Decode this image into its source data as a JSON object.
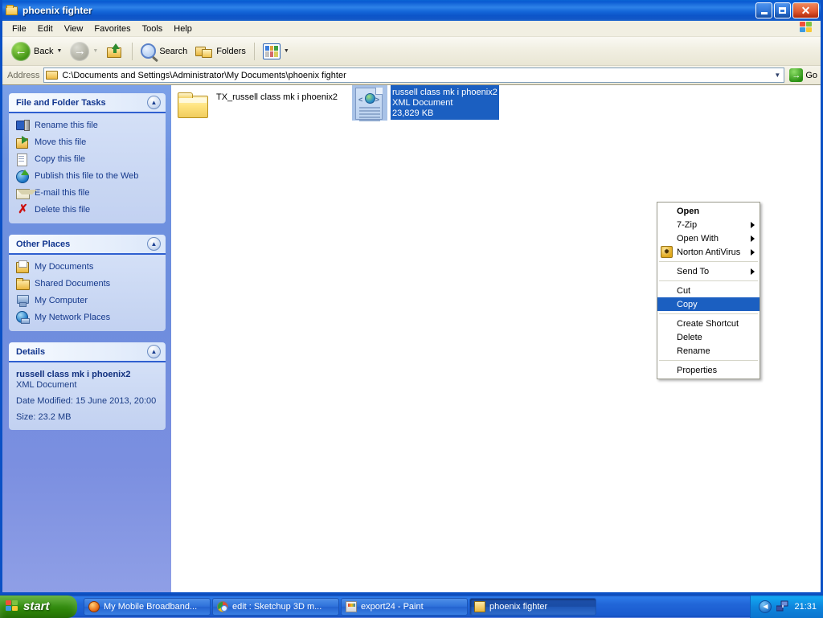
{
  "window": {
    "title": "phoenix fighter",
    "icon": "folder-icon",
    "buttons": {
      "minimize": "Minimize",
      "maximize": "Maximize",
      "close": "Close"
    }
  },
  "menubar": {
    "items": [
      "File",
      "Edit",
      "View",
      "Favorites",
      "Tools",
      "Help"
    ],
    "banner_icon": "windows-flag-icon"
  },
  "toolbar": {
    "back_label": "Back",
    "forward_label": "Forward",
    "up_label": "Up",
    "search_label": "Search",
    "folders_label": "Folders",
    "views_label": "Views"
  },
  "addressbar": {
    "label": "Address",
    "path": "C:\\Documents and Settings\\Administrator\\My Documents\\phoenix fighter",
    "go_label": "Go"
  },
  "sidebar": {
    "panels": [
      {
        "title": "File and Folder Tasks",
        "collapse_icon": "chevron-up-icon",
        "items": [
          {
            "label": "Rename this file",
            "icon": "rename-icon"
          },
          {
            "label": "Move this file",
            "icon": "move-icon"
          },
          {
            "label": "Copy this file",
            "icon": "copy-icon"
          },
          {
            "label": "Publish this file to the Web",
            "icon": "publish-web-icon"
          },
          {
            "label": "E-mail this file",
            "icon": "email-icon"
          },
          {
            "label": "Delete this file",
            "icon": "delete-icon"
          }
        ]
      },
      {
        "title": "Other Places",
        "collapse_icon": "chevron-up-icon",
        "items": [
          {
            "label": "My Documents",
            "icon": "my-documents-icon"
          },
          {
            "label": "Shared Documents",
            "icon": "shared-documents-icon"
          },
          {
            "label": "My Computer",
            "icon": "my-computer-icon"
          },
          {
            "label": "My Network Places",
            "icon": "my-network-places-icon"
          }
        ]
      }
    ],
    "details": {
      "title": "Details",
      "collapse_icon": "chevron-up-icon",
      "file_name": "russell class mk i phoenix2",
      "file_type": "XML Document",
      "date_modified": "Date Modified: 15 June 2013, 20:00",
      "size": "Size: 23.2 MB"
    }
  },
  "files": [
    {
      "name": "TX_russell class mk i phoenix2",
      "icon": "folder-icon",
      "selected": false
    },
    {
      "name": "russell class mk i phoenix2",
      "type": "XML Document",
      "size": "23,829 KB",
      "icon": "xml-document-icon",
      "selected": true
    }
  ],
  "context_menu": {
    "items": [
      {
        "label": "Open",
        "bold": true,
        "submenu": false,
        "selected": false,
        "icon": null
      },
      {
        "label": "7-Zip",
        "bold": false,
        "submenu": true,
        "selected": false,
        "icon": null
      },
      {
        "label": "Open With",
        "bold": false,
        "submenu": true,
        "selected": false,
        "icon": null
      },
      {
        "label": "Norton AntiVirus",
        "bold": false,
        "submenu": true,
        "selected": false,
        "icon": "norton-antivirus-icon"
      },
      {
        "separator": true
      },
      {
        "label": "Send To",
        "bold": false,
        "submenu": true,
        "selected": false,
        "icon": null
      },
      {
        "separator": true
      },
      {
        "label": "Cut",
        "bold": false,
        "submenu": false,
        "selected": false,
        "icon": null
      },
      {
        "label": "Copy",
        "bold": false,
        "submenu": false,
        "selected": true,
        "icon": null
      },
      {
        "separator": true
      },
      {
        "label": "Create Shortcut",
        "bold": false,
        "submenu": false,
        "selected": false,
        "icon": null
      },
      {
        "label": "Delete",
        "bold": false,
        "submenu": false,
        "selected": false,
        "icon": null
      },
      {
        "label": "Rename",
        "bold": false,
        "submenu": false,
        "selected": false,
        "icon": null
      },
      {
        "separator": true
      },
      {
        "label": "Properties",
        "bold": false,
        "submenu": false,
        "selected": false,
        "icon": null
      }
    ]
  },
  "taskbar": {
    "start_label": "start",
    "start_icon": "windows-flag-icon",
    "tasks": [
      {
        "label": "My Mobile Broadband...",
        "icon": "firefox-icon",
        "active": false
      },
      {
        "label": "edit : Sketchup 3D m...",
        "icon": "chrome-icon",
        "active": false
      },
      {
        "label": "export24 - Paint",
        "icon": "paint-icon",
        "active": false
      },
      {
        "label": "phoenix fighter",
        "icon": "folder-icon",
        "active": true
      }
    ],
    "tray": {
      "expand_icon": "chevron-left-icon",
      "network_icon": "network-icon",
      "clock": "21:31"
    }
  },
  "colors": {
    "titlebar_blue": "#0a5ad2",
    "selection_blue": "#1b5fc1",
    "sidebar_blue": "#6e92e0",
    "panel_body": "#c9d7f3",
    "link_text": "#15398c",
    "desktop_blue": "#5a7edc"
  }
}
